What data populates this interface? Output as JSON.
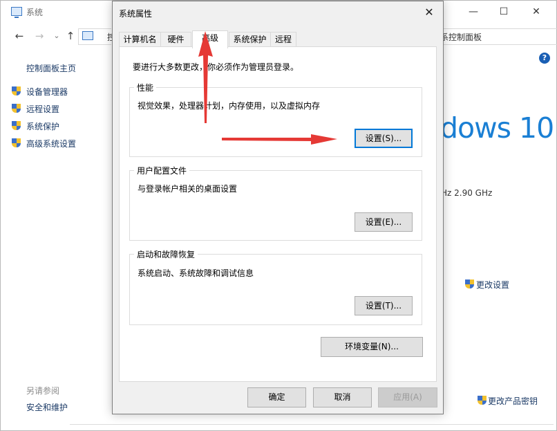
{
  "background_window": {
    "title": "系统",
    "address_partial": "控",
    "address_right": "系控制面板",
    "sidebar": {
      "home": "控制面板主页",
      "items": [
        {
          "label": "设备管理器"
        },
        {
          "label": "远程设置"
        },
        {
          "label": "系统保护"
        },
        {
          "label": "高级系统设置"
        }
      ],
      "see_also": "另请参阅",
      "security": "安全和维护"
    },
    "windows_brand": "dows 10",
    "cpu_speed": "Hz   2.90 GHz",
    "change_settings": "更改设置",
    "change_product_key": "更改产品密钥",
    "help": "?"
  },
  "dialog": {
    "title": "系统属性",
    "close": "✕",
    "tabs": [
      {
        "label": "计算机名"
      },
      {
        "label": "硬件"
      },
      {
        "label": "高级",
        "active": true
      },
      {
        "label": "系统保护"
      },
      {
        "label": "远程"
      }
    ],
    "admin_note": "要进行大多数更改，你必须作为管理员登录。",
    "groups": {
      "performance": {
        "title": "性能",
        "desc": "视觉效果，处理器计划，内存使用，以及虚拟内存",
        "button": "设置(S)..."
      },
      "user_profiles": {
        "title": "用户配置文件",
        "desc": "与登录帐户相关的桌面设置",
        "button": "设置(E)..."
      },
      "startup_recovery": {
        "title": "启动和故障恢复",
        "desc": "系统启动、系统故障和调试信息",
        "button": "设置(T)..."
      }
    },
    "env_button": "环境变量(N)...",
    "ok": "确定",
    "cancel": "取消",
    "apply": "应用(A)"
  },
  "annotation_color": "#e53935"
}
